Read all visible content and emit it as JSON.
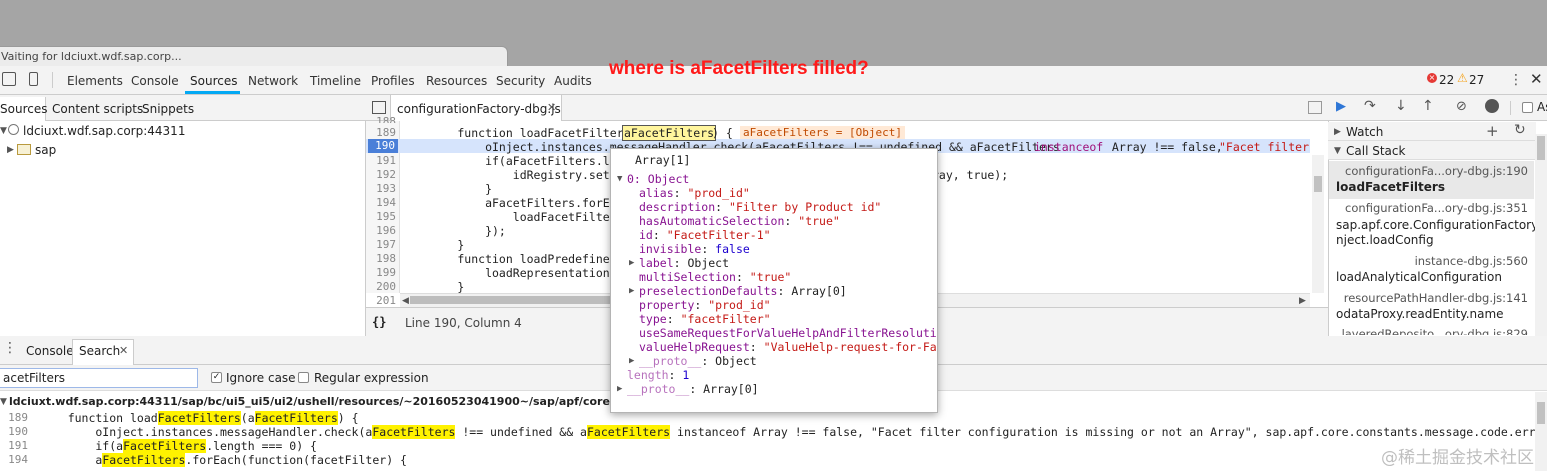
{
  "status_bubble": "Vaiting for ldciuxt.wdf.sap.corp...",
  "annotation": "where is aFacetFilters filled?",
  "devtools": {
    "tabs": [
      "Elements",
      "Console",
      "Sources",
      "Network",
      "Timeline",
      "Profiles",
      "Resources",
      "Security",
      "Audits"
    ],
    "active_tab": "Sources",
    "errors": "22",
    "warnings": "27"
  },
  "navigator": {
    "tabs": [
      "Sources",
      "Content scripts",
      "Snippets"
    ],
    "host": "ldciuxt.wdf.sap.corp:44311",
    "folder": "sap"
  },
  "editor": {
    "file_tab": "configurationFactory-dbg.js",
    "status": "Line 190, Column 4",
    "lines": [
      {
        "n": "189",
        "text": "        function loadFacetFilters("
      },
      {
        "n": "190",
        "text": "            oInject.instances.messageHandler.check(aFacetFilters !== undefined && aFacetFilters "
      },
      {
        "n": "191",
        "text": "            if(aFacetFilters.len"
      },
      {
        "n": "192",
        "text": "                idRegistry.setIt"
      },
      {
        "n": "193",
        "text": "            }"
      },
      {
        "n": "194",
        "text": "            aFacetFilters.forEac"
      },
      {
        "n": "195",
        "text": "                loadFacetFilter("
      },
      {
        "n": "196",
        "text": "            });"
      },
      {
        "n": "197",
        "text": "        }"
      },
      {
        "n": "198",
        "text": "        function loadPredefinedR"
      },
      {
        "n": "199",
        "text": "            loadRepresentationTy"
      },
      {
        "n": "200",
        "text": "        }"
      },
      {
        "n": "201",
        "text": "        /**"
      }
    ],
    "line188": "188",
    "param_token": "aFacetFilters",
    "after_param": ") {",
    "inline_value": "aFacetFilters = [Object]",
    "l190_tail_kw": "instanceof",
    "l190_tail": " Array !== false, ",
    "l190_str": "\"Facet filter",
    "l192_tail": "ray, true);"
  },
  "debugger": {
    "watch": "Watch",
    "call_stack": "Call Stack",
    "frames": [
      {
        "file": "configurationFa...ory-dbg.js:190",
        "fn": "loadFacetFilters"
      },
      {
        "file": "configurationFa...ory-dbg.js:351",
        "fn": "sap.apf.core.ConfigurationFactory.oI",
        "fn2": "nject.loadConfig"
      },
      {
        "file": "instance-dbg.js:560",
        "fn": "loadAnalyticalConfiguration"
      },
      {
        "file": "resourcePathHandler-dbg.js:141",
        "fn": "odataProxy.readEntity.name"
      },
      {
        "file": "layeredReposito...ory-dbg.js:829",
        "fn": ""
      }
    ]
  },
  "popover": {
    "header": "Array[1]",
    "item0": "0: Object",
    "props": [
      {
        "k": "alias",
        "v": "\"prod_id\"",
        "t": "str"
      },
      {
        "k": "description",
        "v": "\"Filter by Product id\"",
        "t": "str"
      },
      {
        "k": "hasAutomaticSelection",
        "v": "\"true\"",
        "t": "str"
      },
      {
        "k": "id",
        "v": "\"FacetFilter-1\"",
        "t": "str"
      },
      {
        "k": "invisible",
        "v": "false",
        "t": "kw"
      },
      {
        "k": "label",
        "v": "Object",
        "t": "obj",
        "exp": true
      },
      {
        "k": "multiSelection",
        "v": "\"true\"",
        "t": "str"
      },
      {
        "k": "preselectionDefaults",
        "v": "Array[0]",
        "t": "obj",
        "exp": true
      },
      {
        "k": "property",
        "v": "\"prod_id\"",
        "t": "str"
      },
      {
        "k": "type",
        "v": "\"facetFilter\"",
        "t": "str"
      },
      {
        "k": "useSameRequestForValueHelpAndFilterResoluti…",
        "v": "",
        "t": "str"
      },
      {
        "k": "valueHelpRequest",
        "v": "\"ValueHelp-request-for-Fa…",
        "t": "str"
      },
      {
        "k": "__proto__",
        "v": "Object",
        "t": "obj",
        "exp": true
      }
    ],
    "length_k": "length",
    "length_v": "1",
    "proto_k": "__proto__",
    "proto_v": "Array[0]"
  },
  "drawer": {
    "tabs": [
      "Console",
      "Search"
    ],
    "search_value": "acetFilters",
    "ignore_case": "Ignore case",
    "regex": "Regular expression",
    "result_path": "ldciuxt.wdf.sap.corp:44311/sap/bc/ui5_ui5/ui2/ushell/resources/~20160523041900~/sap/apf/core/configurationFac",
    "results": [
      {
        "n": "189",
        "parts": [
          "    function load",
          "FacetFilters",
          "(a",
          "FacetFilters",
          ") {"
        ]
      },
      {
        "n": "190",
        "parts": [
          "        oInject.instances.messageHandler.check(a",
          "FacetFilters",
          " !== undefined && a",
          "FacetFilters",
          " instanceof Array !== false, \"Facet filter configuration is missing or not an Array\", sap.apf.core.constants.message.code.errorCheckCon-"
        ]
      },
      {
        "n": "191",
        "parts": [
          "        if(a",
          "FacetFilters",
          ".length === 0) {"
        ]
      },
      {
        "n": "194",
        "parts": [
          "        a",
          "FacetFilters",
          ".forEach(function(facetFilter) {"
        ]
      }
    ]
  },
  "watermark": "@稀土掘金技术社区"
}
